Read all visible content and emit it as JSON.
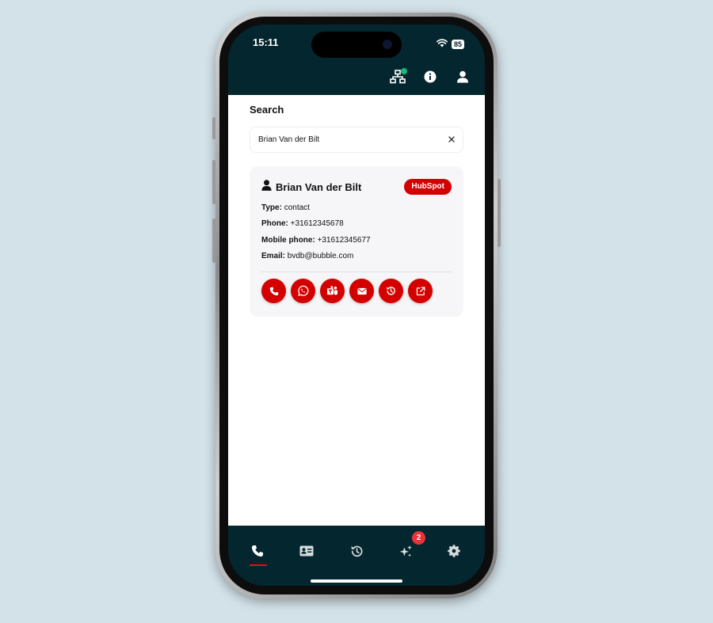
{
  "status_bar": {
    "time": "15:11",
    "battery": "85"
  },
  "search": {
    "title": "Search",
    "value": "Brian Van der Bilt"
  },
  "contact": {
    "name": "Brian Van der Bilt",
    "source": "HubSpot",
    "fields": [
      {
        "label": "Type:",
        "value": "contact"
      },
      {
        "label": "Phone:",
        "value": "+31612345678"
      },
      {
        "label": "Mobile phone:",
        "value": "+31612345677"
      },
      {
        "label": "Email:",
        "value": "bvdb@bubble.com"
      }
    ]
  },
  "bottom_nav": {
    "ai_badge": "2"
  },
  "colors": {
    "brand_dark": "#04262f",
    "accent_red": "#d40000",
    "badge_red": "#e8333a",
    "online_green": "#19b77a"
  },
  "icons": {
    "header": [
      "network-icon",
      "info-icon",
      "user-icon"
    ],
    "actions": [
      "phone-icon",
      "whatsapp-icon",
      "teams-icon",
      "mail-icon",
      "history-icon",
      "external-link-icon"
    ],
    "nav": [
      "phone-icon",
      "contact-card-icon",
      "history-icon",
      "sparkles-icon",
      "gear-icon"
    ]
  }
}
